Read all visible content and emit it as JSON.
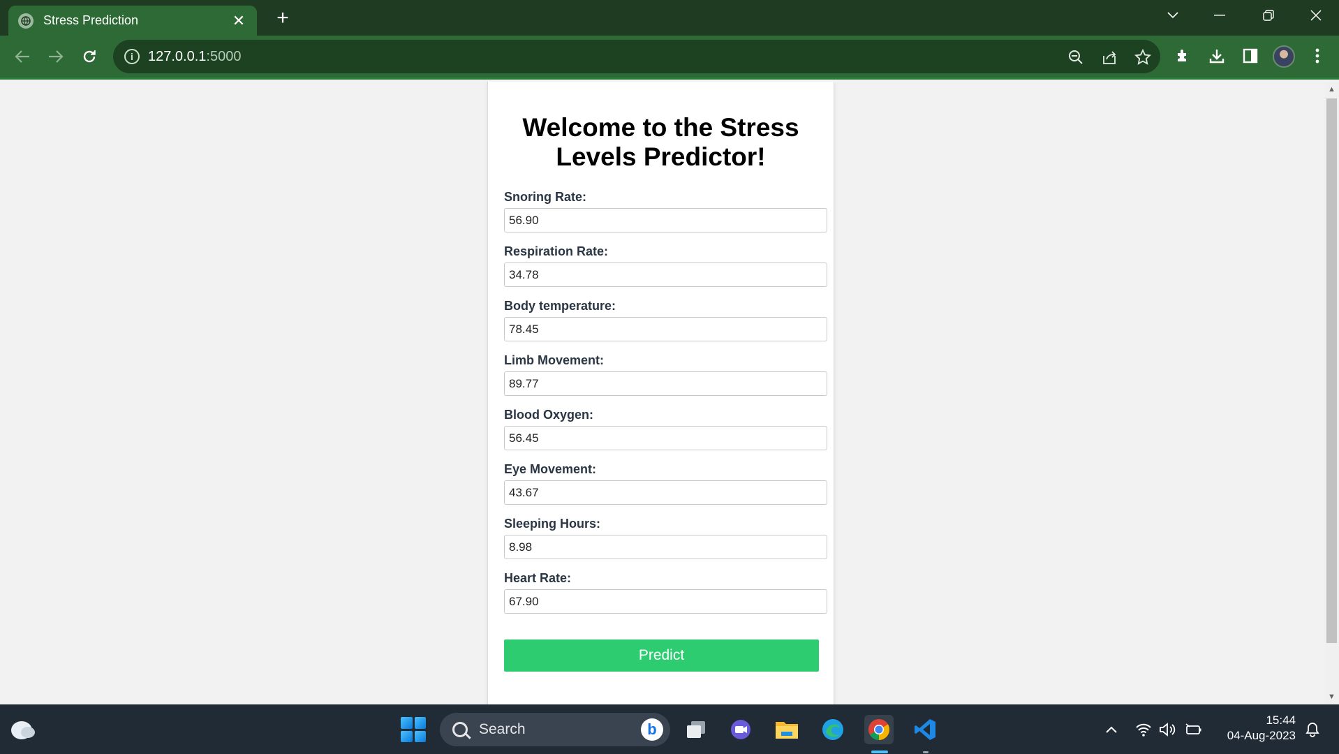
{
  "browser": {
    "tab_title": "Stress Prediction",
    "url_host": "127.0.0.1",
    "url_port": ":5000"
  },
  "page": {
    "heading": "Welcome to the Stress Levels Predictor!",
    "fields": [
      {
        "label": "Snoring Rate:",
        "value": "56.90"
      },
      {
        "label": "Respiration Rate:",
        "value": "34.78"
      },
      {
        "label": "Body temperature:",
        "value": "78.45"
      },
      {
        "label": "Limb Movement:",
        "value": "89.77"
      },
      {
        "label": "Blood Oxygen:",
        "value": "56.45"
      },
      {
        "label": "Eye Movement:",
        "value": "43.67"
      },
      {
        "label": "Sleeping Hours:",
        "value": "8.98"
      },
      {
        "label": "Heart Rate:",
        "value": "67.90"
      }
    ],
    "predict_label": "Predict",
    "accent_color": "#2ecc71"
  },
  "taskbar": {
    "search_placeholder": "Search",
    "time": "15:44",
    "date": "04-Aug-2023"
  }
}
